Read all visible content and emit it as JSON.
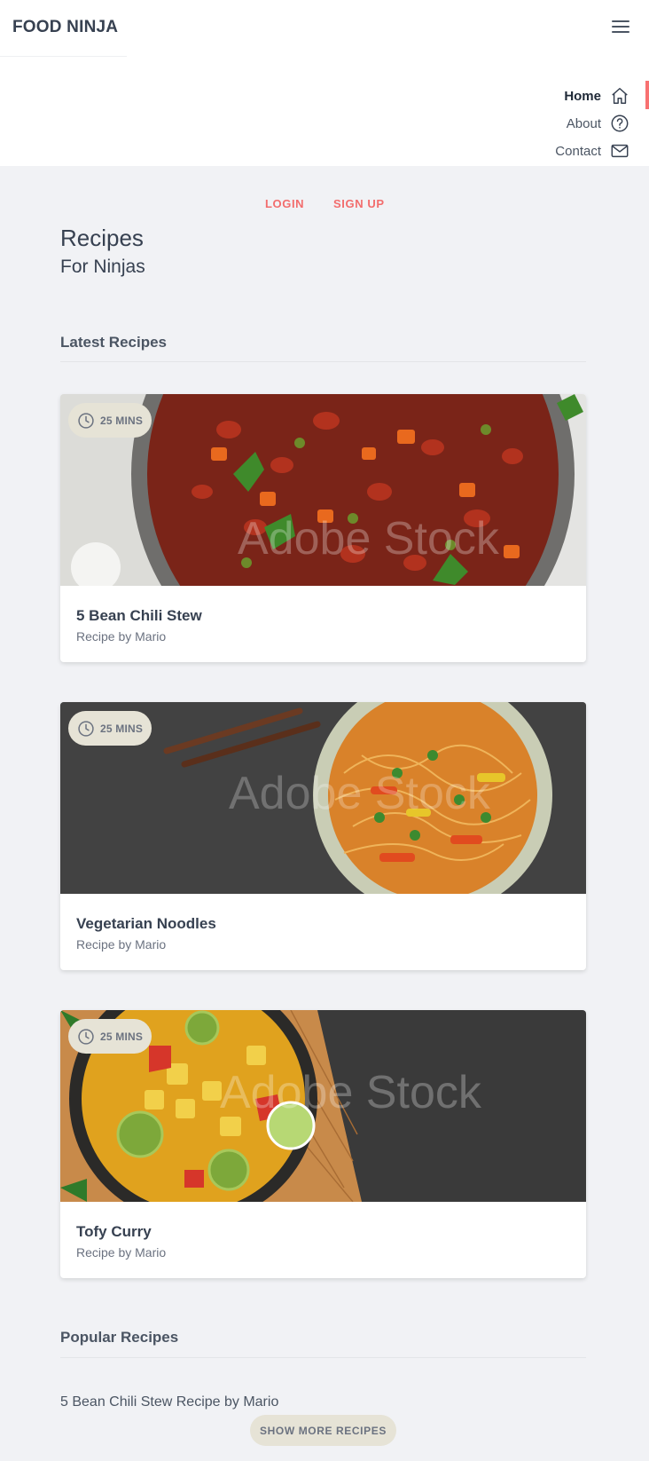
{
  "header": {
    "brand": "FOOD NINJA",
    "menu_icon": "hamburger-menu-icon",
    "nav": [
      {
        "label": "Home",
        "icon": "home-icon",
        "active": true
      },
      {
        "label": "About",
        "icon": "question-circle-icon",
        "active": false
      },
      {
        "label": "Contact",
        "icon": "mail-icon",
        "active": false
      }
    ]
  },
  "auth": {
    "login": "LOGIN",
    "signup": "SIGN UP"
  },
  "hero": {
    "title": "Recipes",
    "subtitle": "For Ninjas"
  },
  "latest": {
    "title": "Latest Recipes",
    "cards": [
      {
        "time": "25 MINS",
        "title": "5 Bean Chili Stew",
        "author": "Recipe by Mario",
        "watermark": "Adobe Stock"
      },
      {
        "time": "25 MINS",
        "title": "Vegetarian Noodles",
        "author": "Recipe by Mario",
        "watermark": "Adobe Stock"
      },
      {
        "time": "25 MINS",
        "title": "Tofy Curry",
        "author": "Recipe by Mario",
        "watermark": "Adobe Stock"
      }
    ]
  },
  "popular": {
    "title": "Popular Recipes",
    "items": [
      {
        "text": "5 Bean Chili Stew Recipe by Mario"
      }
    ],
    "more_button": "SHOW MORE RECIPES"
  },
  "colors": {
    "accent": "#f26d6d",
    "page_bg": "#f1f2f5",
    "badge_bg": "#e6e3d6",
    "text_dark": "#374151"
  }
}
